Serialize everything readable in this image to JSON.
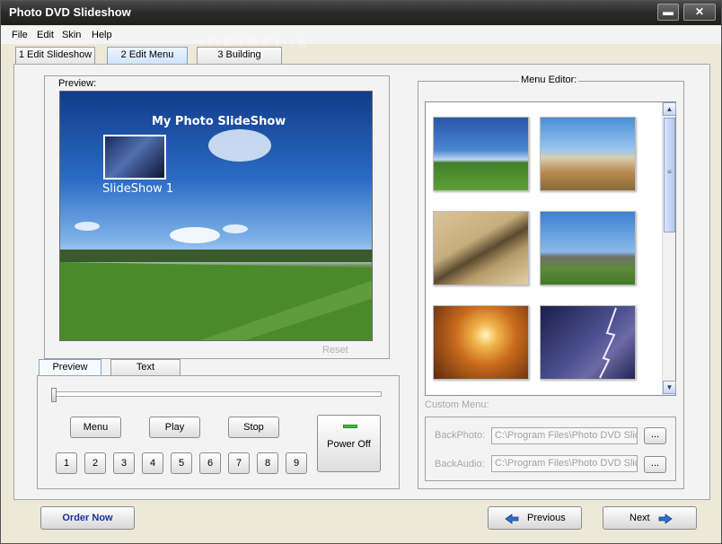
{
  "window": {
    "title": "Photo DVD Slideshow",
    "minimize": "▬",
    "close": "✕"
  },
  "menu": [
    "File",
    "Edit",
    "Skin",
    "Help"
  ],
  "main_tabs": [
    "1 Edit Slideshow",
    "2 Edit Menu",
    "3 Building"
  ],
  "preview": {
    "label": "Preview:",
    "menu_title": "My Photo SlideShow",
    "thumb_label": "SlideShow 1",
    "reset": "Reset"
  },
  "sub_tabs": [
    "Preview",
    "Text"
  ],
  "controls": {
    "menu": "Menu",
    "play": "Play",
    "stop": "Stop",
    "power": "Power Off",
    "numbers": [
      "1",
      "2",
      "3",
      "4",
      "5",
      "6",
      "7",
      "8",
      "9"
    ],
    "slider_position": 0
  },
  "editor": {
    "label": "Menu Editor:",
    "thumbnails": [
      "field-sky-thumbnail",
      "wheat-field-thumbnail",
      "sand-dune-thumbnail",
      "stonehenge-thumbnail",
      "sunset-thumbnail",
      "lightning-thumbnail"
    ]
  },
  "custom_menu": {
    "label": "Custom Menu:",
    "back_photo_label": "BackPhoto:",
    "back_photo_path": "C:\\Program Files\\Photo DVD Slide",
    "back_audio_label": "BackAudio:",
    "back_audio_path": "C:\\Program Files\\Photo DVD Slide",
    "browse": "..."
  },
  "footer": {
    "order": "Order Now",
    "previous": "Previous",
    "next": "Next"
  },
  "colors": {
    "accent": "#1a2fa8",
    "title_bar": "#2c2c2c",
    "power_led": "#3bbf3b"
  }
}
